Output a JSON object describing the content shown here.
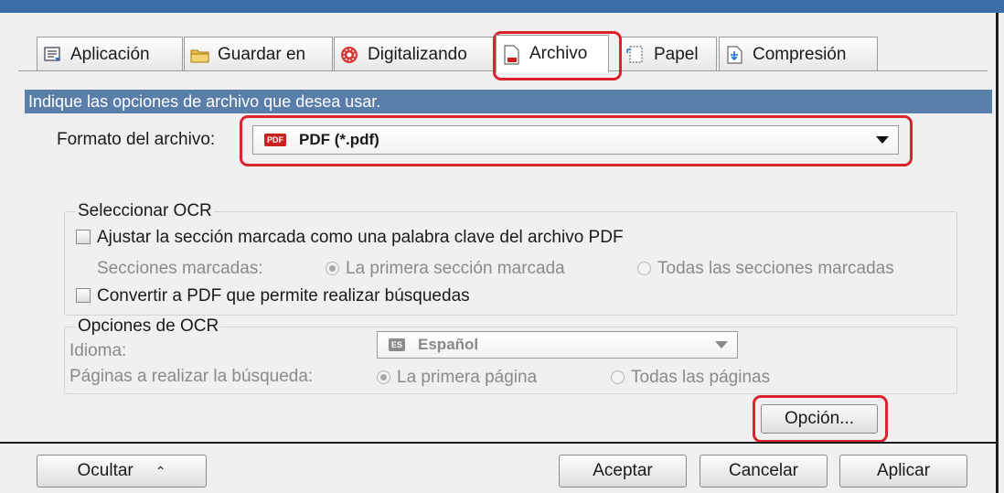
{
  "tabs": [
    {
      "label": "Aplicación",
      "icon": "application-icon"
    },
    {
      "label": "Guardar en",
      "icon": "folder-icon"
    },
    {
      "label": "Digitalizando",
      "icon": "scanning-icon"
    },
    {
      "label": "Archivo",
      "icon": "file-icon",
      "active": true
    },
    {
      "label": "Papel",
      "icon": "paper-icon"
    },
    {
      "label": "Compresión",
      "icon": "compression-icon"
    }
  ],
  "info_text": "Indique las opciones de archivo que desea usar.",
  "file_format": {
    "label": "Formato del archivo:",
    "badge": "PDF",
    "value": "PDF (*.pdf)"
  },
  "ocr_select": {
    "legend": "Seleccionar OCR",
    "keyword_checkbox": "Ajustar la sección marcada como una palabra clave del archivo PDF",
    "marked_sections_label": "Secciones marcadas:",
    "first_marked": "La primera sección marcada",
    "all_marked": "Todas las secciones marcadas",
    "searchable_checkbox": "Convertir a PDF que permite realizar búsquedas"
  },
  "ocr_options": {
    "legend": "Opciones de OCR",
    "language_label": "Idioma:",
    "language_badge": "ES",
    "language_value": "Español",
    "pages_label": "Páginas a realizar la búsqueda:",
    "first_page": "La primera página",
    "all_pages": "Todas las páginas"
  },
  "option_button": "Opción...",
  "footer": {
    "hide": "Ocultar",
    "accept": "Aceptar",
    "cancel": "Cancelar",
    "apply": "Aplicar"
  },
  "colors": {
    "highlight": "#d9232e",
    "info_bar": "#5a7eaa",
    "title_bar": "#3a6ea8"
  }
}
